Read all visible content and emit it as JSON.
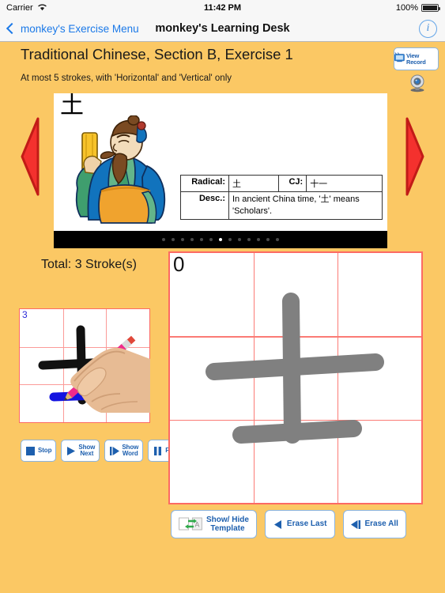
{
  "status_bar": {
    "carrier": "Carrier",
    "wifi_icon": "wifi-icon",
    "time": "11:42 PM",
    "battery_percent": "100%",
    "battery_icon": "battery-full-icon"
  },
  "nav_bar": {
    "back_icon": "chevron-left-icon",
    "back_label": "monkey's Exercise Menu",
    "title": "monkey's Learning Desk",
    "info_icon": "info-circle-icon",
    "info_glyph": "i"
  },
  "header": {
    "exercise_title": "Traditional Chinese, Section B, Exercise 1",
    "exercise_subtitle": "At most 5 strokes, with 'Horizontal' and 'Vertical' only",
    "view_record": {
      "label": "View Record",
      "icon": "tv-monitor-icon"
    },
    "webcam_icon": "webcam-icon"
  },
  "navigation": {
    "prev_arrow_icon": "triangle-left-icon",
    "next_arrow_icon": "triangle-right-icon",
    "arrow_color": "#f4312e"
  },
  "card": {
    "character": "土",
    "illustration": "chinese-scholar-illustration",
    "table": {
      "radical_label": "Radical:",
      "radical_value": "土",
      "cj_label": "CJ:",
      "cj_value": "十一",
      "desc_label": "Desc.:",
      "desc_value": "In ancient China time, '土' means 'Scholars'."
    },
    "pager": {
      "total": 13,
      "active_index": 6
    }
  },
  "practice": {
    "total_strokes_label": "Total: 3 Stroke(s)",
    "mini_grid": {
      "stroke_number": "3",
      "hand_icon": "hand-with-pencil-photo",
      "grid_color": "#fc6a63"
    },
    "playback_buttons": [
      {
        "label_line1": "Stop",
        "label_line2": "",
        "icon": "stop-square-icon"
      },
      {
        "label_line1": "Show",
        "label_line2": "Next",
        "icon": "play-triangle-icon"
      },
      {
        "label_line1": "Show",
        "label_line2": "Word",
        "icon": "skip-next-icon"
      },
      {
        "label_line1": "Pause",
        "label_line2": "",
        "icon": "pause-bars-icon"
      }
    ]
  },
  "canvas": {
    "stroke_count": "0",
    "written_character": "土",
    "stroke_color": "#808080",
    "grid_color": "#fc6a63"
  },
  "actions": [
    {
      "label_line1": "Show/ Hide",
      "label_line2": "Template",
      "icon": "swap-template-icon"
    },
    {
      "label_line1": "Erase Last",
      "label_line2": "",
      "icon": "step-back-icon"
    },
    {
      "label_line1": "Erase All",
      "label_line2": "",
      "icon": "skip-back-icon"
    }
  ],
  "theme": {
    "background": "#fbc864",
    "accent_blue": "#1d5fae",
    "grid_red": "#fc6a63"
  }
}
